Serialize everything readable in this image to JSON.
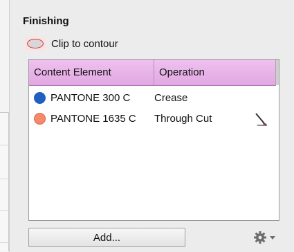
{
  "finishing": {
    "title": "Finishing",
    "clip_to_contour": {
      "label": "Clip to contour",
      "icon": "clip-contour-icon"
    },
    "table": {
      "columns": [
        "Content Element",
        "Operation"
      ],
      "rows": [
        {
          "color": "#1f5fbf",
          "content_element": "PANTONE 300 C",
          "operation": "Crease"
        },
        {
          "color": "#f58a6a",
          "content_element": "PANTONE 1635 C",
          "operation": "Through Cut",
          "icon": "cutting-tool-icon"
        }
      ]
    },
    "add_button": "Add...",
    "settings_icon": "gear-icon"
  },
  "colors": {
    "header_accent": "#e2a7e2",
    "clip_icon_stroke": "#d33c3c"
  }
}
